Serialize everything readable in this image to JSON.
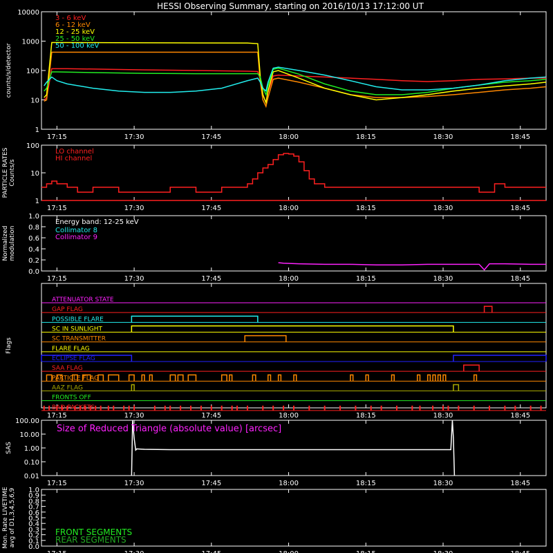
{
  "title": "HESSI Observing Summary, starting on 2016/10/13 17:12:00 UT",
  "colors": {
    "background": "#000000",
    "axes": "#ffffff",
    "red": "#ff2020",
    "orange": "#ff8800",
    "yellow": "#ffff00",
    "green": "#22ee22",
    "cyan": "#22eeee",
    "magenta": "#ff22ff",
    "blue": "#2222ff",
    "olive": "#aaaa00",
    "white": "#ffffff",
    "darkgreen": "#22aa22"
  },
  "time_axis": {
    "start_minutes": 0,
    "end_minutes": 98,
    "tick_labels": [
      "17:15",
      "17:30",
      "17:45",
      "18:00",
      "18:15",
      "18:30",
      "18:45"
    ],
    "tick_minutes": [
      3,
      18,
      33,
      48,
      63,
      78,
      93
    ]
  },
  "chart_data": [
    {
      "type": "line",
      "ylabel": "counts/s/detector",
      "yscale": "log",
      "ylim": [
        1,
        10000
      ],
      "y_tick_labels": [
        "1",
        "10",
        "100",
        "1000",
        "10000"
      ],
      "y_ticks": [
        1,
        10,
        100,
        1000,
        10000
      ],
      "legend_position": "top-left",
      "series": [
        {
          "name": "3 - 6 keV",
          "color_key": "red",
          "x": [
            0.5,
            1,
            2,
            3,
            5,
            10,
            20,
            30,
            40,
            42,
            42.5,
            43,
            43.6,
            44,
            45,
            46,
            50,
            55,
            60,
            65,
            70,
            75,
            80,
            85,
            90,
            95,
            98
          ],
          "y": [
            10,
            12,
            115,
            115,
            115,
            112,
            105,
            100,
            95,
            92,
            50,
            15,
            8,
            18,
            65,
            70,
            65,
            60,
            55,
            50,
            45,
            42,
            45,
            50,
            52,
            55,
            55
          ]
        },
        {
          "name": "6 - 12 keV",
          "color_key": "orange",
          "x": [
            0.5,
            1,
            2,
            3,
            10,
            20,
            30,
            40,
            42,
            42.5,
            43,
            43.6,
            44,
            45,
            46,
            50,
            55,
            60,
            65,
            70,
            75,
            80,
            85,
            90,
            95,
            98
          ],
          "y": [
            9,
            10,
            420,
            420,
            420,
            420,
            420,
            420,
            420,
            40,
            10,
            6,
            12,
            50,
            55,
            40,
            25,
            15,
            12,
            12,
            13,
            15,
            18,
            22,
            25,
            28
          ]
        },
        {
          "name": "12 - 25 keV",
          "color_key": "yellow",
          "x": [
            0.5,
            1,
            2,
            3,
            10,
            20,
            30,
            40,
            42,
            42.5,
            43,
            43.6,
            44,
            45,
            46,
            50,
            55,
            60,
            65,
            70,
            75,
            80,
            85,
            90,
            95,
            98
          ],
          "y": [
            12,
            15,
            900,
            900,
            890,
            880,
            870,
            860,
            820,
            60,
            15,
            8,
            20,
            90,
            100,
            55,
            25,
            15,
            10,
            12,
            15,
            20,
            25,
            30,
            35,
            40
          ]
        },
        {
          "name": "25 - 50 keV",
          "color_key": "green",
          "x": [
            0.5,
            1,
            2,
            3,
            10,
            20,
            30,
            40,
            42,
            42.5,
            43,
            43.6,
            44,
            45,
            46,
            50,
            55,
            60,
            65,
            70,
            75,
            80,
            85,
            90,
            95,
            98
          ],
          "y": [
            20,
            25,
            90,
            90,
            85,
            80,
            78,
            78,
            78,
            60,
            25,
            15,
            30,
            110,
            120,
            75,
            35,
            20,
            15,
            15,
            18,
            25,
            32,
            40,
            45,
            50
          ]
        },
        {
          "name": "50 - 100 keV",
          "color_key": "cyan",
          "x": [
            0.5,
            1,
            2,
            3,
            5,
            10,
            15,
            20,
            25,
            30,
            35,
            40,
            42,
            42.5,
            43,
            43.6,
            44,
            45,
            46,
            50,
            55,
            60,
            65,
            70,
            75,
            80,
            85,
            90,
            95,
            98
          ],
          "y": [
            30,
            40,
            60,
            45,
            35,
            25,
            20,
            18,
            18,
            20,
            25,
            45,
            55,
            40,
            25,
            20,
            40,
            120,
            130,
            100,
            70,
            45,
            28,
            22,
            22,
            25,
            32,
            45,
            55,
            60
          ]
        }
      ]
    },
    {
      "type": "line",
      "ylabel": "PARTICLE RATES Counts/s",
      "yscale": "log",
      "ylim": [
        1,
        100
      ],
      "y_tick_labels": [
        "1",
        "10",
        "100"
      ],
      "y_ticks": [
        1,
        10,
        100
      ],
      "legend_position": "top-left",
      "series": [
        {
          "name": "LO channel",
          "color_key": "red",
          "step": true,
          "x": [
            0,
            1,
            2,
            3,
            5,
            7,
            10,
            15,
            20,
            25,
            30,
            35,
            38,
            40,
            41,
            42,
            43,
            44,
            45,
            46,
            47,
            48,
            49,
            50,
            51,
            52,
            53,
            55,
            60,
            65,
            70,
            75,
            80,
            85,
            88,
            90,
            95,
            98
          ],
          "y": [
            3,
            4,
            5,
            4,
            3,
            2,
            3,
            2,
            2,
            3,
            2,
            3,
            3,
            4,
            6,
            10,
            15,
            20,
            30,
            45,
            50,
            48,
            40,
            25,
            12,
            6,
            4,
            3,
            3,
            3,
            3,
            3,
            3,
            2,
            4,
            3,
            3,
            3
          ]
        },
        {
          "name": "HI channel",
          "color_key": "red",
          "x": [
            0,
            98
          ],
          "y": [
            1,
            1
          ]
        }
      ]
    },
    {
      "type": "line",
      "ylabel": "Normalized modulation",
      "ylim": [
        0,
        1
      ],
      "y_tick_labels": [
        "0.0",
        "0.2",
        "0.4",
        "0.6",
        "0.8",
        "1.0"
      ],
      "y_ticks": [
        0,
        0.2,
        0.4,
        0.6,
        0.8,
        1.0
      ],
      "legend_position": "top-left",
      "annotation": "Energy band: 12-25 keV",
      "series": [
        {
          "name": "Collimator 8",
          "color_key": "cyan",
          "x": [],
          "y": []
        },
        {
          "name": "Collimator 9",
          "color_key": "magenta",
          "x": [
            46,
            47,
            50,
            55,
            60,
            65,
            70,
            75,
            80,
            85,
            86,
            87,
            90,
            95,
            98
          ],
          "y": [
            0.15,
            0.14,
            0.13,
            0.12,
            0.12,
            0.11,
            0.11,
            0.12,
            0.12,
            0.12,
            0.02,
            0.13,
            0.13,
            0.12,
            0.12
          ]
        }
      ]
    },
    {
      "type": "table",
      "ylabel": "Flags",
      "flags": [
        {
          "name": "ATTENUATOR STATE",
          "color_key": "magenta",
          "segments": []
        },
        {
          "name": "GAP FLAG",
          "color_key": "red",
          "segments": [
            [
              86,
              87.5
            ]
          ]
        },
        {
          "name": "POSSIBLE FLARE",
          "color_key": "cyan",
          "segments": [
            [
              17.5,
              42
            ]
          ]
        },
        {
          "name": "SC IN SUNLIGHT",
          "color_key": "yellow",
          "segments": [
            [
              17.5,
              80
            ]
          ]
        },
        {
          "name": "SC TRANSMITTER",
          "color_key": "orange",
          "segments": [
            [
              39.5,
              47.5
            ]
          ]
        },
        {
          "name": "FLARE FLAG",
          "color_key": "yellow",
          "segments": []
        },
        {
          "name": "ECLIPSE FLAG",
          "color_key": "blue",
          "segments": [
            [
              0,
              17.5
            ],
            [
              80,
              98
            ]
          ]
        },
        {
          "name": "SAA FLAG",
          "color_key": "red",
          "segments": [
            [
              82,
              85
            ]
          ]
        },
        {
          "name": "PARTICLE FLAG",
          "color_key": "orange",
          "segments": [
            [
              1,
              2
            ],
            [
              3,
              4
            ],
            [
              6,
              7
            ],
            [
              8,
              9.5
            ],
            [
              11,
              12
            ],
            [
              13,
              15
            ],
            [
              17,
              18
            ],
            [
              19.5,
              20
            ],
            [
              21,
              21.5
            ],
            [
              25,
              26
            ],
            [
              26.5,
              27.5
            ],
            [
              28.5,
              30
            ],
            [
              35,
              36
            ],
            [
              36.5,
              37
            ],
            [
              41,
              41.6
            ],
            [
              44,
              44.5
            ],
            [
              46,
              46.5
            ],
            [
              49,
              49.5
            ],
            [
              60,
              60.5
            ],
            [
              63,
              63.5
            ],
            [
              68,
              68.5
            ],
            [
              73,
              73.5
            ],
            [
              75,
              75.5
            ],
            [
              76,
              76.5
            ],
            [
              77,
              77.5
            ],
            [
              78,
              78.5
            ],
            [
              84,
              84.5
            ]
          ]
        },
        {
          "name": "AAZ FLAG",
          "color_key": "olive",
          "segments": [
            [
              17.5,
              18
            ],
            [
              80,
              81
            ]
          ]
        },
        {
          "name": "FRONTS OFF",
          "color_key": "green",
          "segments": []
        },
        {
          "name": "BAD PACKETS",
          "color_key": "red",
          "ticks": [
            0.5,
            1.5,
            3,
            4,
            5,
            6.5,
            7.5,
            8.5,
            9.5,
            10.5,
            11.5,
            13,
            14,
            16,
            17,
            18,
            22,
            24,
            25,
            27,
            29,
            31,
            33,
            35,
            37,
            38,
            40,
            43,
            45,
            47,
            49,
            52,
            55,
            58,
            61,
            64,
            66,
            69,
            72,
            73.5,
            76,
            78,
            79,
            81,
            84,
            87,
            90,
            92,
            95,
            97
          ]
        }
      ]
    },
    {
      "type": "line",
      "ylabel": "SAS",
      "yscale": "log",
      "ylim": [
        0.01,
        100
      ],
      "y_tick_labels": [
        "0.01",
        "0.10",
        "1.00",
        "10.00",
        "100.00"
      ],
      "y_ticks": [
        0.01,
        0.1,
        1,
        10,
        100
      ],
      "legend_position": "top-left",
      "series": [
        {
          "name": "Size of Reduced Triangle (absolute value) [arcsec]",
          "color_key": "white",
          "x": [
            17.5,
            17.7,
            18,
            18.3,
            18.5,
            20,
            25,
            30,
            40,
            50,
            60,
            70,
            79.5,
            79.8,
            80,
            80.2
          ],
          "y": [
            0.01,
            100,
            5,
            0.7,
            0.85,
            0.8,
            0.75,
            0.75,
            0.75,
            0.75,
            0.75,
            0.75,
            0.75,
            100,
            5,
            0.01
          ]
        }
      ]
    },
    {
      "type": "line",
      "ylabel": "Mon. Rate LIVETIME avg of D1,3,4,5,6,9",
      "ylim": [
        0,
        1
      ],
      "y_tick_labels": [
        "0.0",
        "0.1",
        "0.2",
        "0.3",
        "0.4",
        "0.5",
        "0.6",
        "0.7",
        "0.8",
        "0.9",
        "1.0"
      ],
      "y_ticks": [
        0,
        0.1,
        0.2,
        0.3,
        0.4,
        0.5,
        0.6,
        0.7,
        0.8,
        0.9,
        1.0
      ],
      "legend_position": "bottom-left",
      "series": [
        {
          "name": "FRONT SEGMENTS",
          "color_key": "green",
          "x": [],
          "y": []
        },
        {
          "name": "REAR SEGMENTS",
          "color_key": "darkgreen",
          "x": [],
          "y": []
        }
      ]
    }
  ]
}
